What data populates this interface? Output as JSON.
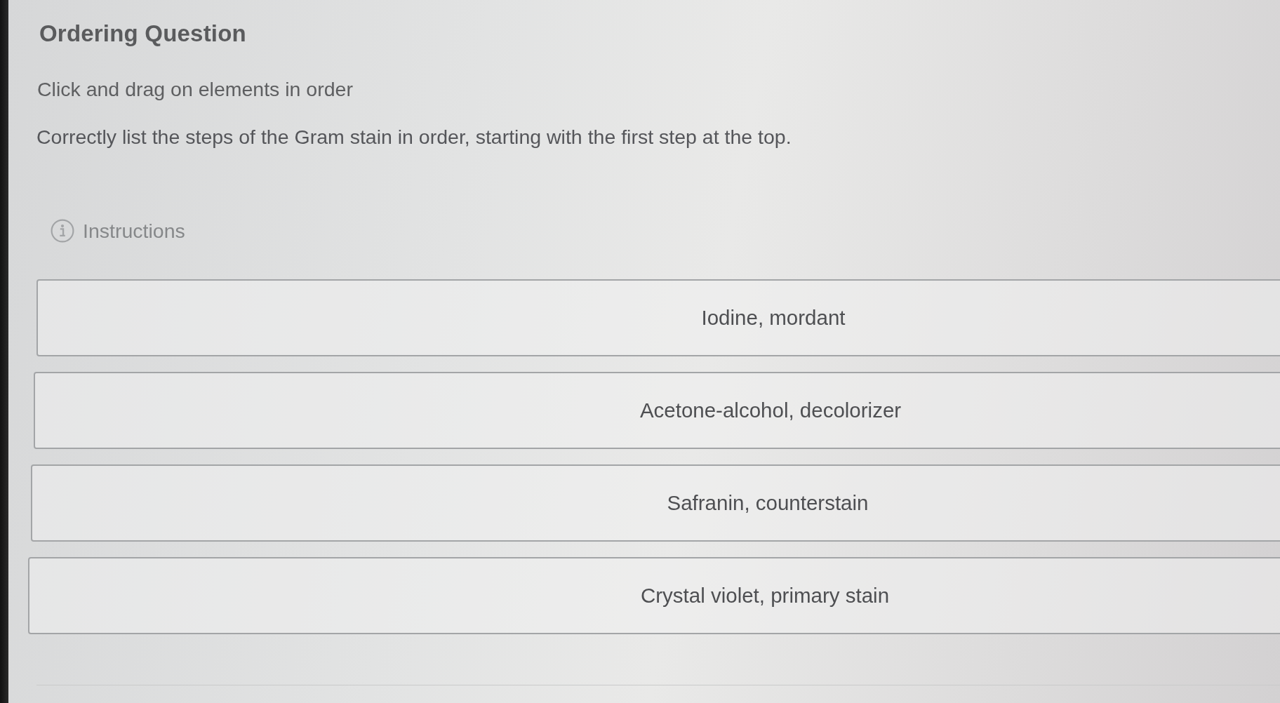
{
  "header": {
    "title": "Ordering Question"
  },
  "question": {
    "hint": "Click and drag on elements in order",
    "text": "Correctly list the steps of the Gram stain in order, starting with the first step at the top."
  },
  "instructions": {
    "label": "Instructions"
  },
  "items": [
    {
      "label": "Iodine, mordant"
    },
    {
      "label": "Acetone-alcohol, decolorizer"
    },
    {
      "label": "Safranin, counterstain"
    },
    {
      "label": "Crystal violet, primary stain"
    }
  ]
}
